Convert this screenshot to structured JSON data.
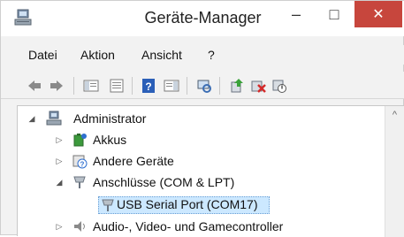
{
  "window": {
    "title": "Geräte-Manager",
    "minimize_glyph": "–",
    "maximize_glyph": "□",
    "close_glyph": "✕",
    "accent_close": "#c7463d"
  },
  "menu": {
    "items": [
      "Datei",
      "Aktion",
      "Ansicht",
      "?"
    ]
  },
  "toolbar": {
    "buttons": [
      "back-icon",
      "forward-icon",
      "show-hide-console-tree-icon",
      "properties-icon",
      "help-icon",
      "show-action-pane-icon",
      "scan-hardware-icon",
      "update-driver-icon",
      "uninstall-icon",
      "disable-device-icon"
    ]
  },
  "tree": {
    "root": "Administrator",
    "items": [
      {
        "label": "Akkus",
        "expander": "▷",
        "icon": "battery-icon"
      },
      {
        "label": "Andere Geräte",
        "expander": "▷",
        "icon": "unknown-device-icon"
      },
      {
        "label": "Anschlüsse (COM & LPT)",
        "expander": "◢",
        "icon": "port-icon"
      },
      {
        "label": "USB Serial Port (COM17)",
        "expander": "",
        "icon": "port-icon",
        "selected": true
      },
      {
        "label": "Audio-, Video- und Gamecontroller",
        "expander": "▷",
        "icon": "speaker-icon"
      }
    ],
    "root_expander": "◢"
  },
  "scrollbar": {
    "up_glyph": "^"
  }
}
